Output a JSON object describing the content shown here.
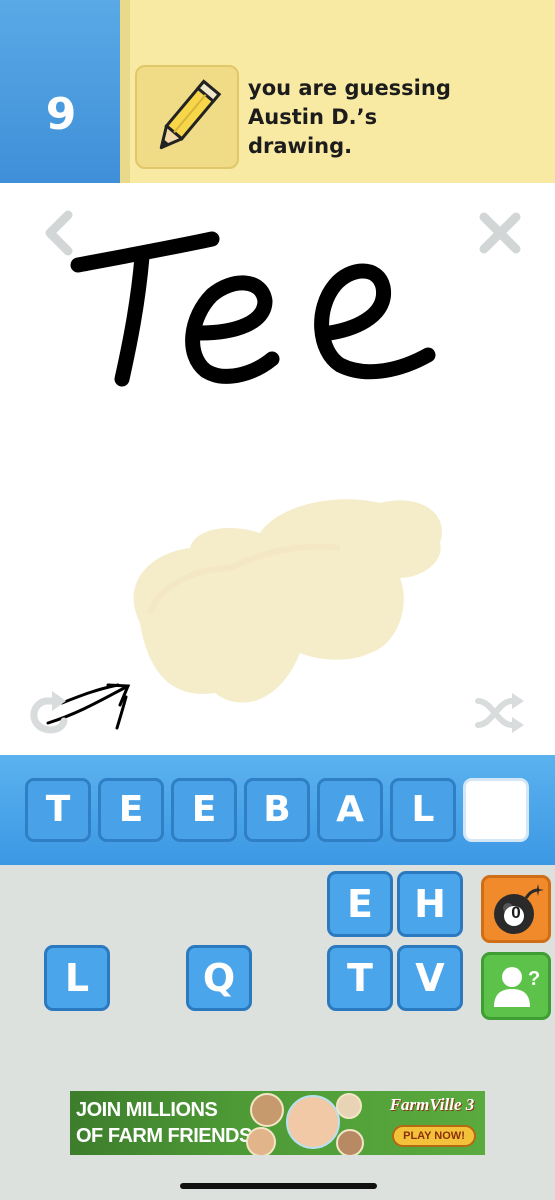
{
  "header": {
    "score": "9",
    "turn_line1": "you are guessing",
    "turn_line2": "Austin D.’s",
    "turn_line3": "drawing."
  },
  "canvas": {
    "drawn_text": "Tee",
    "icons": [
      "back-arrow-icon",
      "close-icon",
      "replay-icon",
      "shuffle-icon"
    ],
    "colors": {
      "ink": "#000000",
      "fill": "#f5ecca"
    }
  },
  "answer": {
    "slots": [
      "T",
      "E",
      "E",
      "B",
      "A",
      "L",
      ""
    ]
  },
  "keyboard": {
    "keys": [
      "E",
      "H",
      "L",
      "Q",
      "T",
      "V"
    ],
    "bomb_count": "0",
    "hint_icon": "person-question-icon"
  },
  "ad": {
    "line1": "JOIN MILLIONS",
    "line2": "OF FARM FRIENDS",
    "brand": "FarmVille 3",
    "cta": "PLAY NOW!"
  },
  "colors": {
    "score_blue": "#4a9ee0",
    "banner_yellow": "#f8e9a3",
    "key_blue": "#4aa5ea",
    "bomb_orange": "#f08a2a",
    "hint_green": "#5cc24a",
    "keyboard_bg": "#dde1dd"
  }
}
